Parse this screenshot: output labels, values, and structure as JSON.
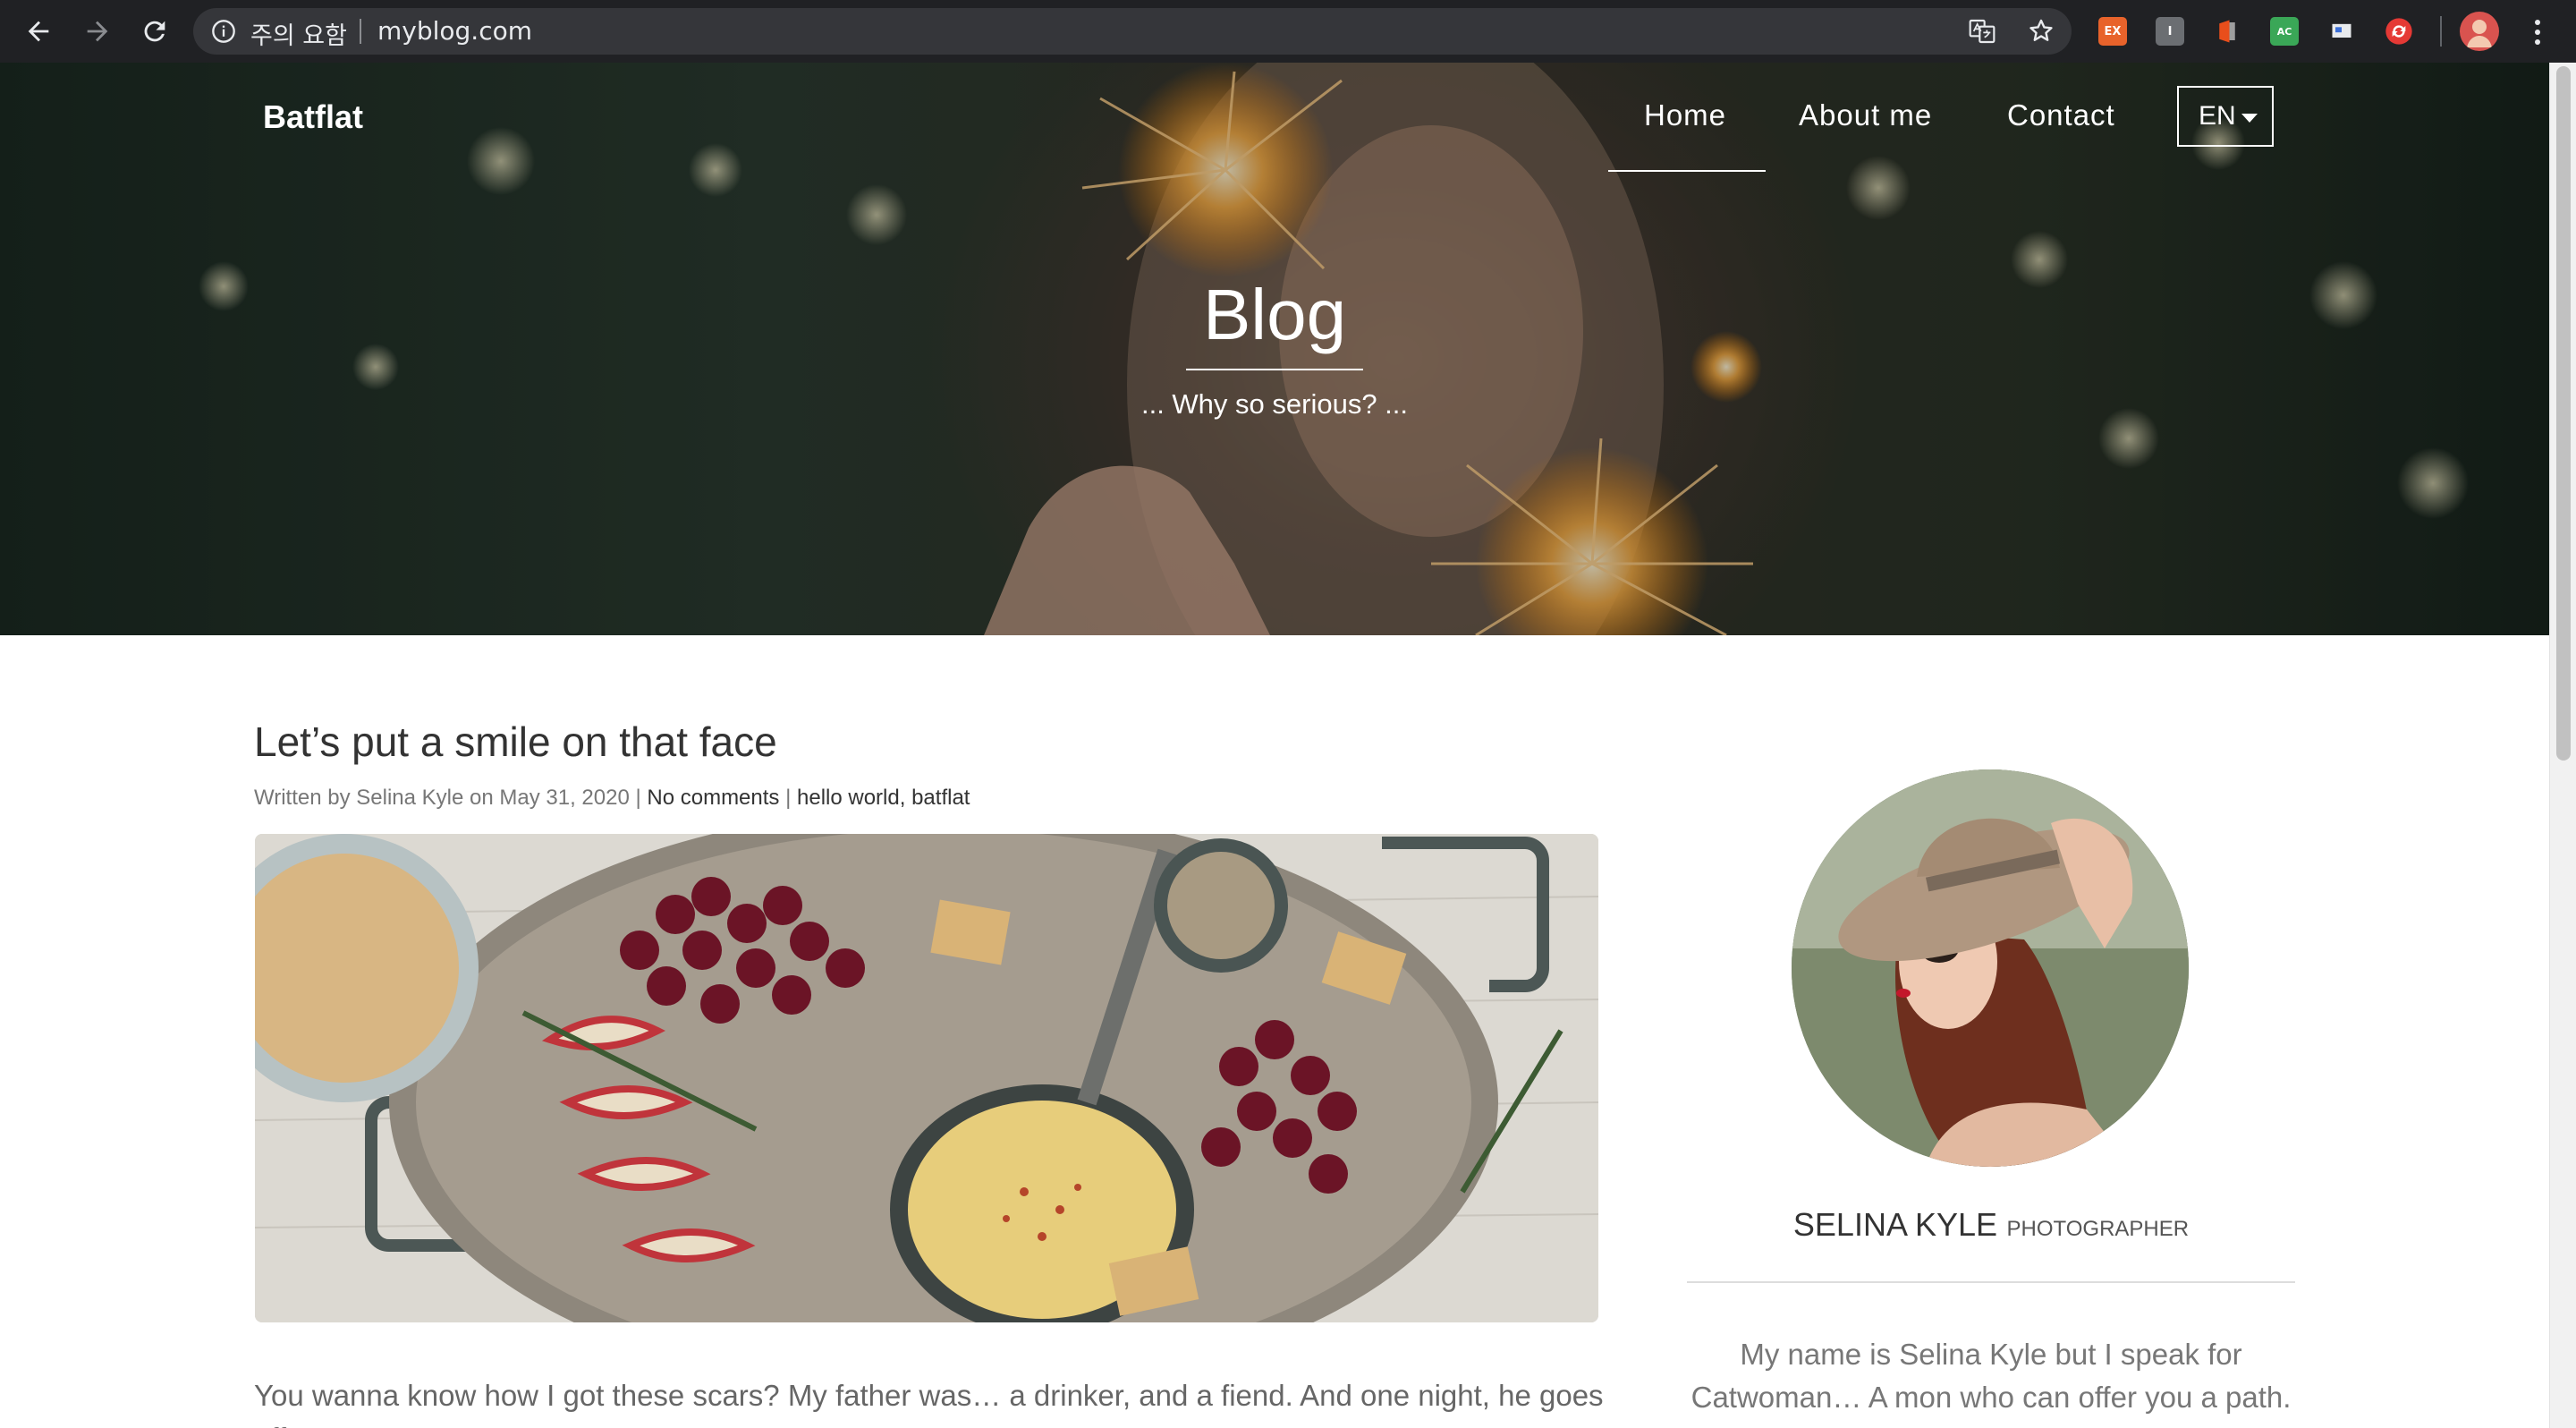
{
  "browser": {
    "security_warning": "주의 요함",
    "url": "myblog.com",
    "icons": [
      "back-icon",
      "forward-icon",
      "reload-icon",
      "info-icon",
      "translate-icon",
      "star-icon",
      "extension-icons",
      "profile-avatar",
      "menu-dots-icon"
    ]
  },
  "site": {
    "brand": "Batflat",
    "nav": [
      {
        "label": "Home",
        "active": true
      },
      {
        "label": "About me",
        "active": false
      },
      {
        "label": "Contact",
        "active": false
      }
    ],
    "language": "EN"
  },
  "hero": {
    "title": "Blog",
    "subtitle": "... Why so serious? ..."
  },
  "post": {
    "title": "Let’s put a smile on that face",
    "meta_prefix": "Written by Selina Kyle on May 31, 2020",
    "meta_sep": " | ",
    "comments": "No comments",
    "tag_1": "hello world",
    "tag_sep": ", ",
    "tag_2": "batflat",
    "excerpt": "You wanna know how I got these scars? My father was… a drinker, and a fiend. And one night, he goes off"
  },
  "sidebar": {
    "author_name": "SELINA KYLE",
    "author_role": "PHOTOGRAPHER",
    "bio": "My name is Selina Kyle but I speak for Catwoman… A mon who can offer you a path."
  },
  "colors": {
    "chrome_bg": "#202124",
    "omnibox_bg": "#35363a",
    "text_dark": "#333333",
    "text_muted": "#777777"
  }
}
